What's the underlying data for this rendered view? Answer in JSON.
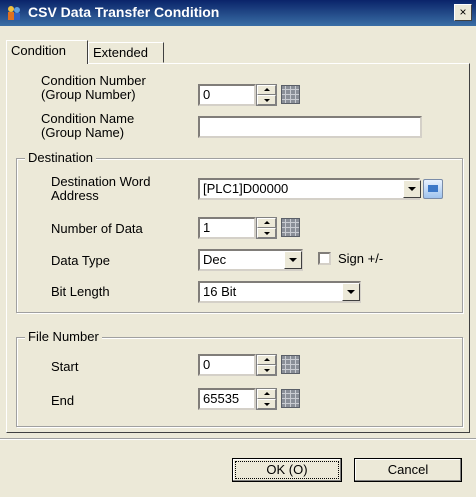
{
  "window": {
    "title": "CSV Data Transfer Condition",
    "close_glyph": "×",
    "app_icon": "people-icon"
  },
  "tabs": [
    {
      "label": "Condition",
      "selected": true
    },
    {
      "label": "Extended",
      "selected": false
    }
  ],
  "condition": {
    "number_label": "Condition Number\n(Group Number)",
    "number_value": "0",
    "name_label": "Condition Name\n(Group Name)",
    "name_value": ""
  },
  "destination": {
    "group_label": "Destination",
    "word_address_label": "Destination Word\nAddress",
    "word_address_value": "[PLC1]D00000",
    "number_of_data_label": "Number of Data",
    "number_of_data_value": "1",
    "data_type_label": "Data Type",
    "data_type_value": "Dec",
    "sign_label": "Sign +/-",
    "sign_checked": false,
    "bit_length_label": "Bit Length",
    "bit_length_value": "16 Bit"
  },
  "file_number": {
    "group_label": "File Number",
    "start_label": "Start",
    "start_value": "0",
    "end_label": "End",
    "end_value": "65535"
  },
  "buttons": {
    "ok": "OK (O)",
    "cancel": "Cancel"
  },
  "colors": {
    "title_bar": "#0a246a",
    "dialog_bg": "#ece9d8"
  }
}
